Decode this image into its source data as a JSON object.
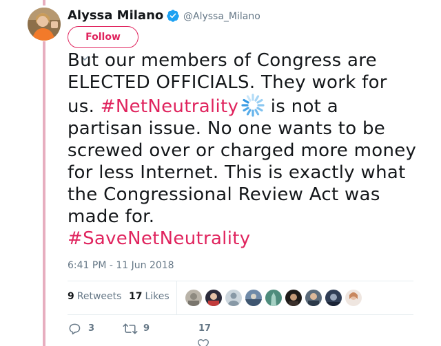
{
  "author": {
    "name": "Alyssa Milano",
    "handle": "@Alyssa_Milano",
    "verified": true
  },
  "follow_button": {
    "label": "Follow"
  },
  "tweet": {
    "text_before": "But our members of Congress are ELECTED OFFICIALS. They work for us. ",
    "hashtag_1": "#NetNeutrality",
    "text_after": " is not a partisan issue. No one wants to be screwed over  or charged more money for less Internet. This is exactly what the Congressional Review Act was made for.",
    "hashtag_2": "#SaveNetNeutrality"
  },
  "timestamp": "6:41 PM - 11 Jun 2018",
  "stats": {
    "retweets_count": "9",
    "retweets_label": "Retweets",
    "likes_count": "17",
    "likes_label": "Likes"
  },
  "actions": {
    "reply_count": "3",
    "retweet_count": "9",
    "like_count": "17"
  },
  "colors": {
    "accent": "#e0245e",
    "muted": "#657786",
    "text": "#14171a",
    "verified": "#1da1f2",
    "thread_line": "#e7aebf"
  },
  "icons": {
    "verified": "verified-badge-icon",
    "caret": "caret-down-icon",
    "hashtag_emoji": "loading-spinner-icon",
    "reply": "reply-icon",
    "retweet": "retweet-icon",
    "like": "heart-icon"
  }
}
